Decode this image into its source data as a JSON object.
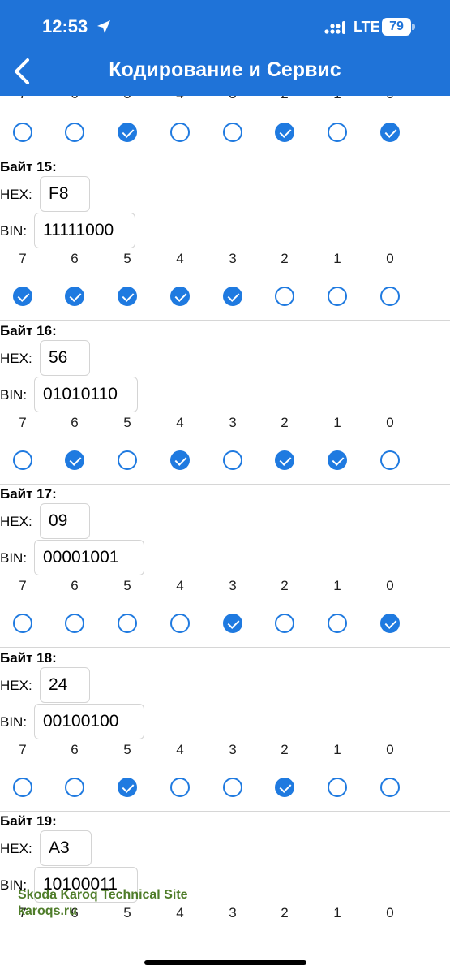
{
  "status": {
    "time": "12:53",
    "network": "LTE",
    "battery": "79"
  },
  "nav": {
    "title": "Кодирование и Сервис"
  },
  "bit_labels": [
    "7",
    "6",
    "5",
    "4",
    "3",
    "2",
    "1",
    "0"
  ],
  "hex_label": "HEX:",
  "bin_label": "BIN:",
  "top_partial": {
    "checks": [
      false,
      false,
      true,
      false,
      false,
      true,
      false,
      true
    ]
  },
  "bytes": [
    {
      "title": "Байт 15:",
      "hex": "F8",
      "bin": "11111000",
      "checks": [
        true,
        true,
        true,
        true,
        true,
        false,
        false,
        false
      ]
    },
    {
      "title": "Байт 16:",
      "hex": "56",
      "bin": "01010110",
      "checks": [
        false,
        true,
        false,
        true,
        false,
        true,
        true,
        false
      ]
    },
    {
      "title": "Байт 17:",
      "hex": "09",
      "bin": "00001001",
      "checks": [
        false,
        false,
        false,
        false,
        true,
        false,
        false,
        true
      ]
    },
    {
      "title": "Байт 18:",
      "hex": "24",
      "bin": "00100100",
      "checks": [
        false,
        false,
        true,
        false,
        false,
        true,
        false,
        false
      ]
    },
    {
      "title": "Байт 19:",
      "hex": "A3",
      "bin": "10100011"
    }
  ],
  "watermark": {
    "line1": "Skoda Karoq Technical Site",
    "line2": "karoqs.ru"
  },
  "colors": {
    "header": "#1f73d8",
    "accent": "#1f7ae0"
  }
}
